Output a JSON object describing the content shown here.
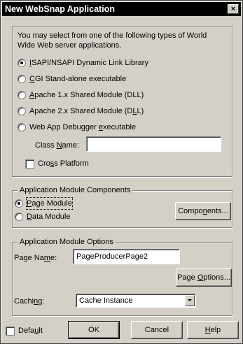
{
  "window": {
    "title": "New WebSnap Application",
    "close_glyph": "×"
  },
  "server_types": {
    "intro_line1": "You may select from one of the following types of World",
    "intro_line2": "Wide Web server applications.",
    "options": [
      {
        "label": "ISAPI/NSAPI Dynamic Link Library",
        "selected": true
      },
      {
        "label": "CGI Stand-alone executable",
        "selected": false
      },
      {
        "label": "Apache 1.x Shared Module (DLL)",
        "selected": false
      },
      {
        "label": "Apache 2.x Shared Module (DLL)",
        "selected": false
      },
      {
        "label": "Web App Debugger executable",
        "selected": false
      }
    ],
    "class_name_label": "Class Name:",
    "class_name_value": "",
    "cross_platform_label": "Cross Platform",
    "cross_platform_checked": false
  },
  "components_group": {
    "title": "Application Module Components",
    "options": [
      {
        "label": "Page Module",
        "selected": true
      },
      {
        "label": "Data Module",
        "selected": false
      }
    ],
    "components_button": "Components..."
  },
  "options_group": {
    "title": "Application Module Options",
    "page_name_label": "Page Name:",
    "page_name_value": "PageProducerPage2",
    "page_options_button": "Page Options...",
    "caching_label": "Caching:",
    "caching_value": "Cache Instance"
  },
  "footer": {
    "default_label": "Default",
    "default_checked": false,
    "ok_button": "OK",
    "cancel_button": "Cancel",
    "help_button": "Help"
  },
  "colors": {
    "dialog_face": "#d4d0c8",
    "title_bar": "#000000",
    "field_bg": "#ffffff"
  }
}
